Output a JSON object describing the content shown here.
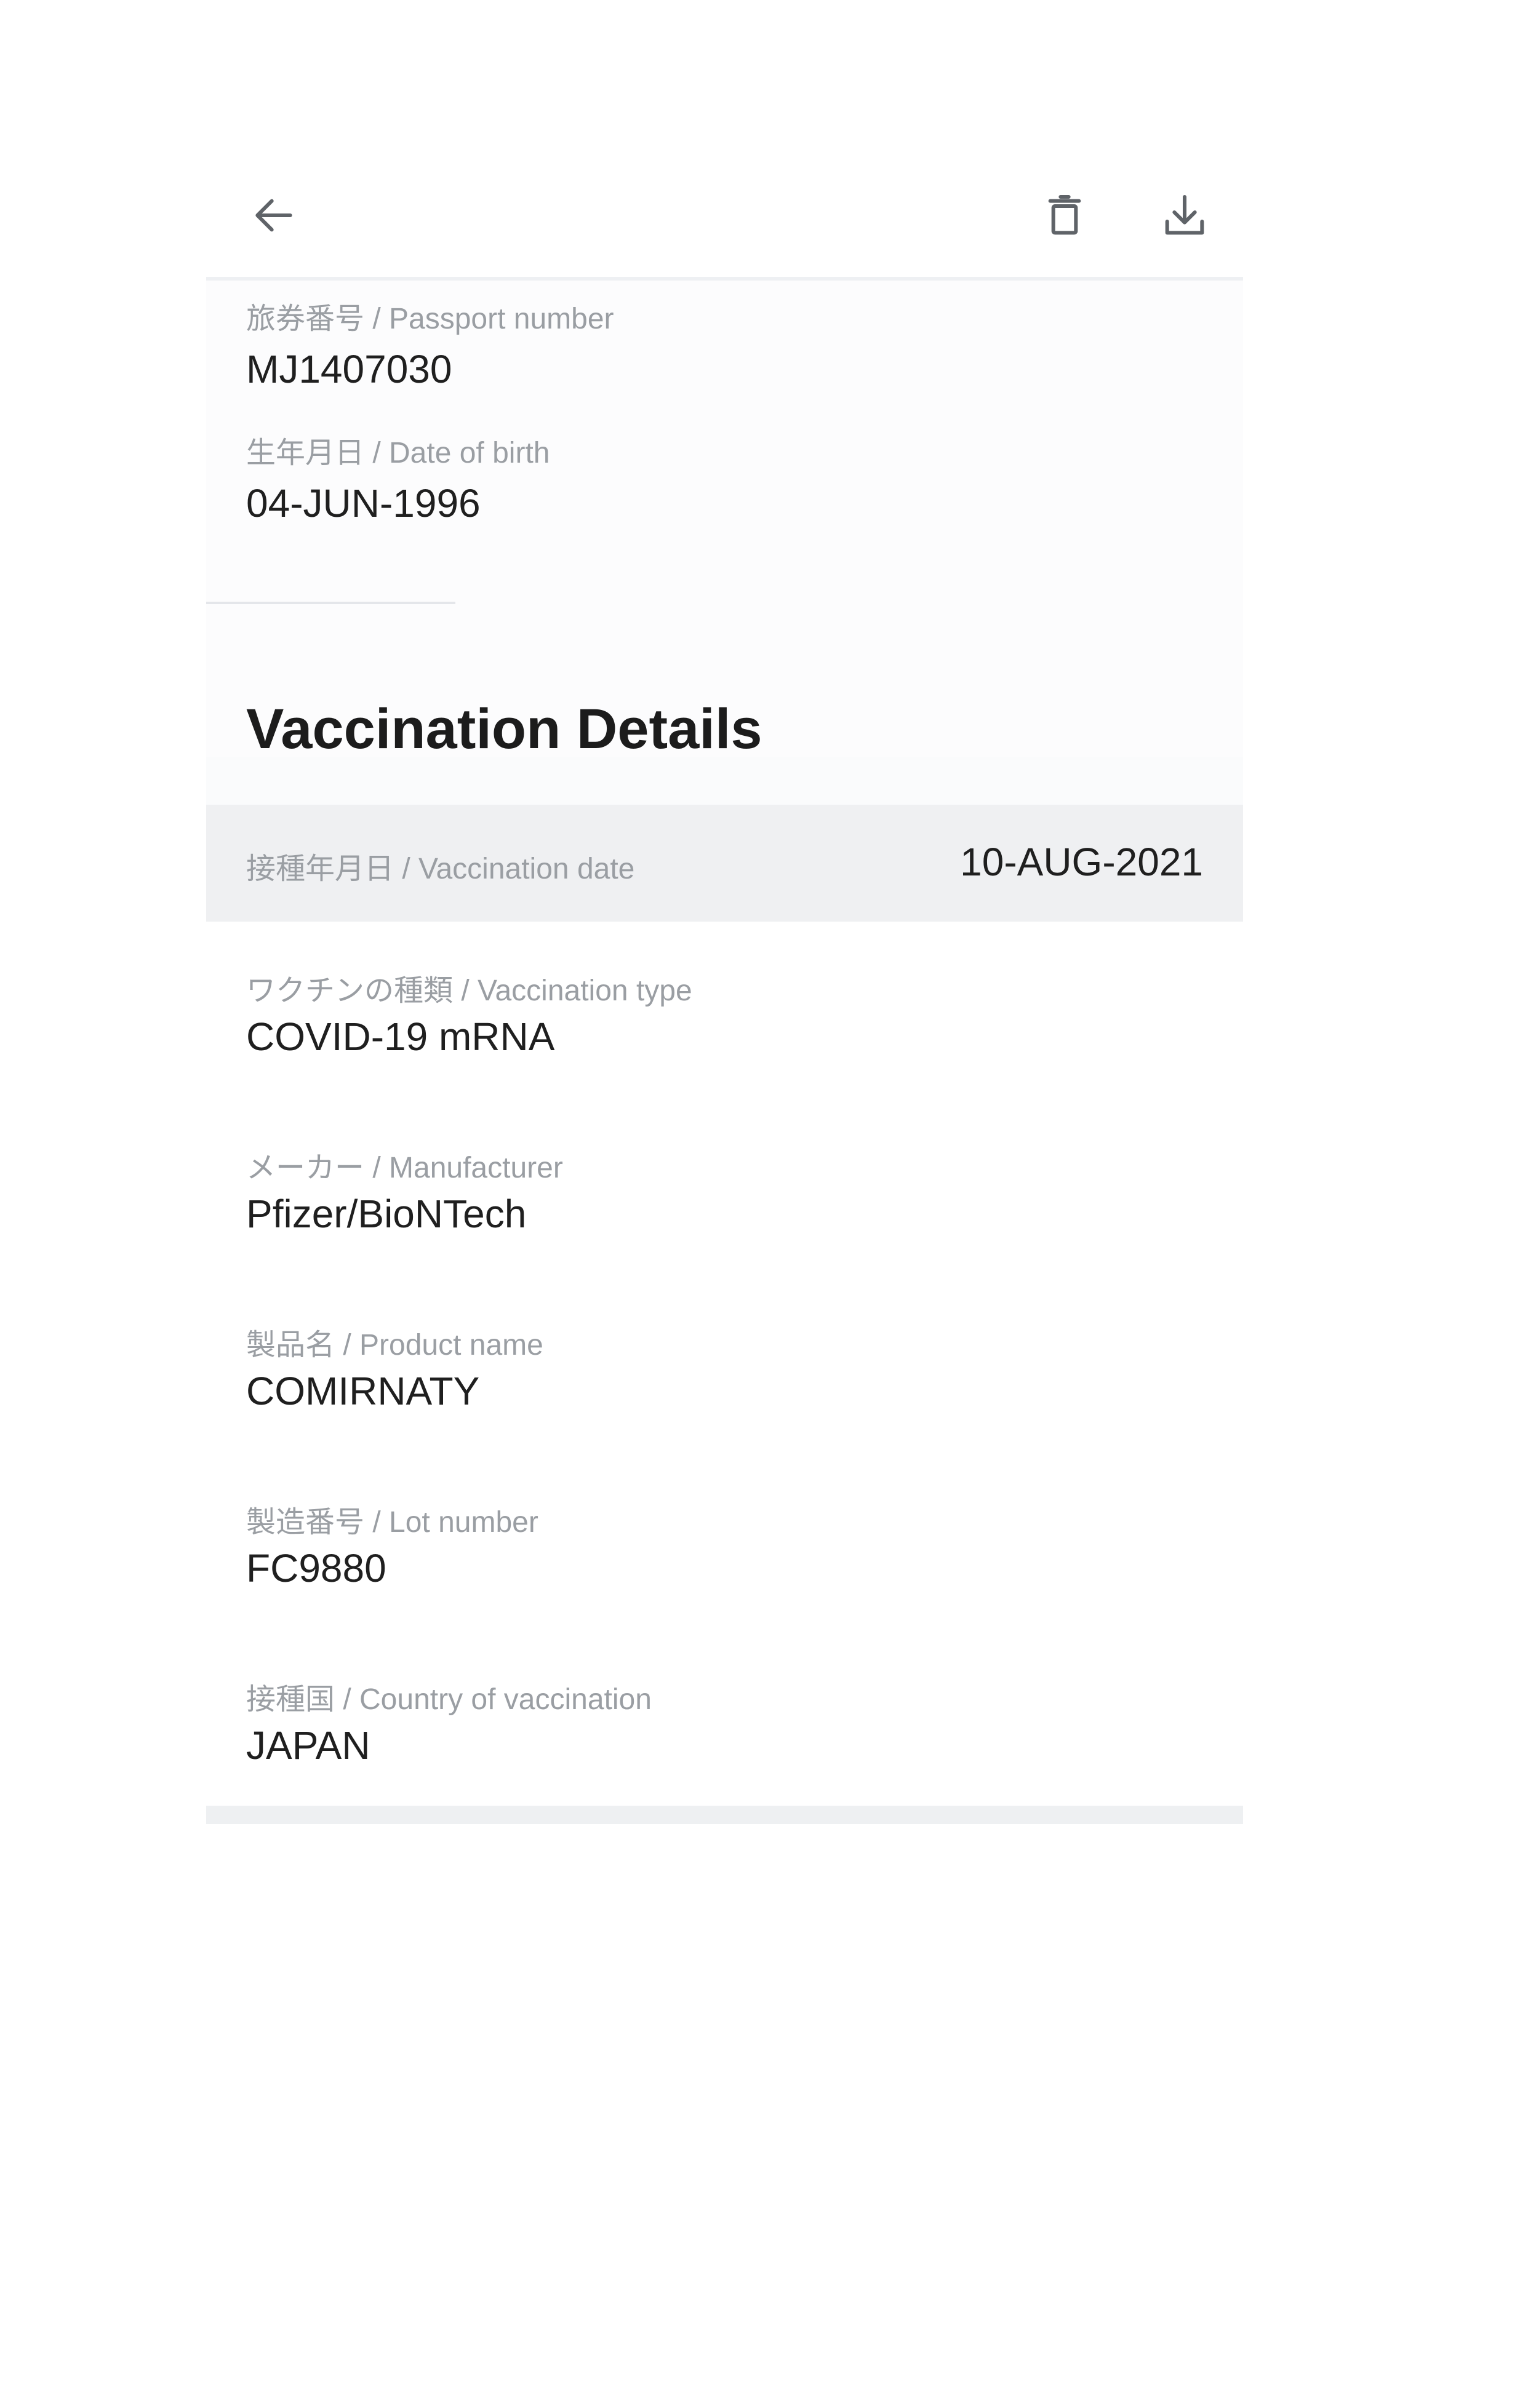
{
  "toolbar": {
    "back_icon": "arrow-left-icon",
    "delete_icon": "trash-icon",
    "download_icon": "download-icon",
    "icon_color": "#5f6368"
  },
  "personal": {
    "passport": {
      "label": "旅券番号 / Passport number",
      "value": "MJ1407030"
    },
    "dob": {
      "label": "生年月日 / Date of birth",
      "value": "04-JUN-1996"
    }
  },
  "vaccination": {
    "title": "Vaccination Details",
    "date": {
      "label": "接種年月日 / Vaccination date",
      "value": "10-AUG-2021"
    },
    "rows": [
      {
        "label": "ワクチンの種類 / Vaccination type",
        "value": "COVID-19 mRNA"
      },
      {
        "label": "メーカー / Manufacturer",
        "value": "Pfizer/BioNTech"
      },
      {
        "label": "製品名 / Product name",
        "value": "COMIRNATY"
      },
      {
        "label": "製造番号 / Lot number",
        "value": "FC9880"
      },
      {
        "label": "接種国 / Country of vaccination",
        "value": "JAPAN"
      }
    ]
  },
  "colors": {
    "highlight_row": "#eff0f2",
    "label_text": "#9a9ea3",
    "value_text": "#1f1f1f"
  }
}
